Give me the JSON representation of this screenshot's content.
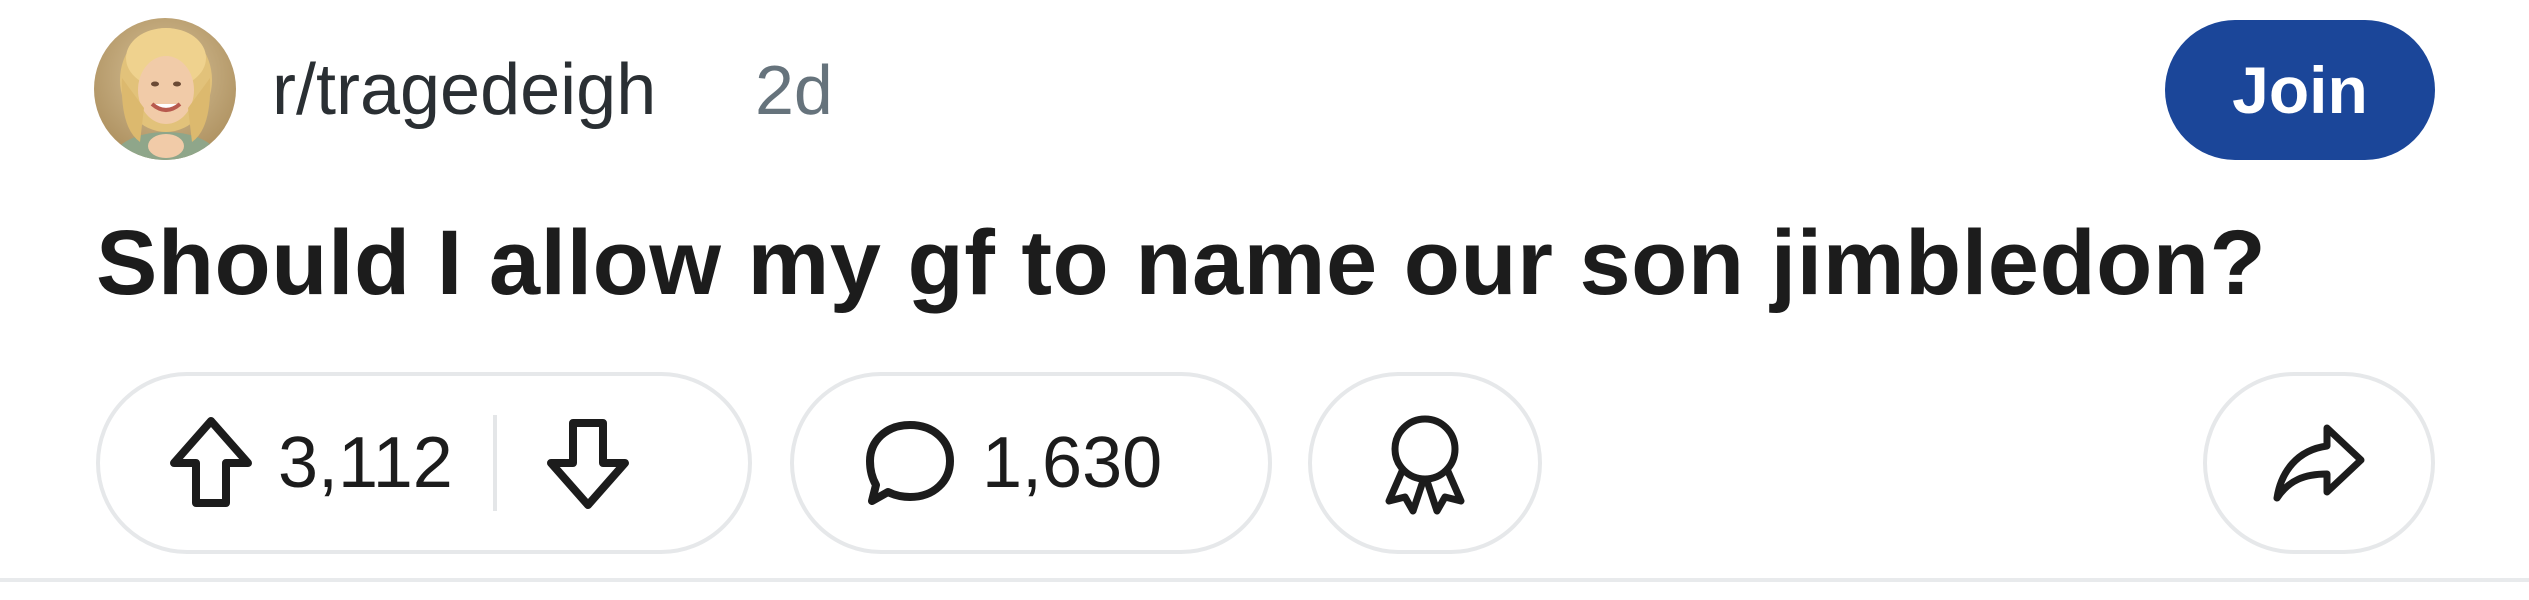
{
  "post": {
    "subreddit": "r/tragedeigh",
    "age": "2d",
    "join_label": "Join",
    "title": "Should I allow my gf to name our son jimbledon?",
    "score": "3,112",
    "comments": "1,630"
  },
  "icons": {
    "avatar": "user-avatar",
    "upvote": "arrow-up-outline-icon",
    "downvote": "arrow-down-outline-icon",
    "comment": "speech-bubble-icon",
    "award": "award-ribbon-icon",
    "share": "share-arrow-icon"
  },
  "colors": {
    "join_button": "#1b4699",
    "text_primary": "#1c1c1c",
    "text_secondary": "#66737c",
    "pill_border": "#e6e8ea"
  }
}
